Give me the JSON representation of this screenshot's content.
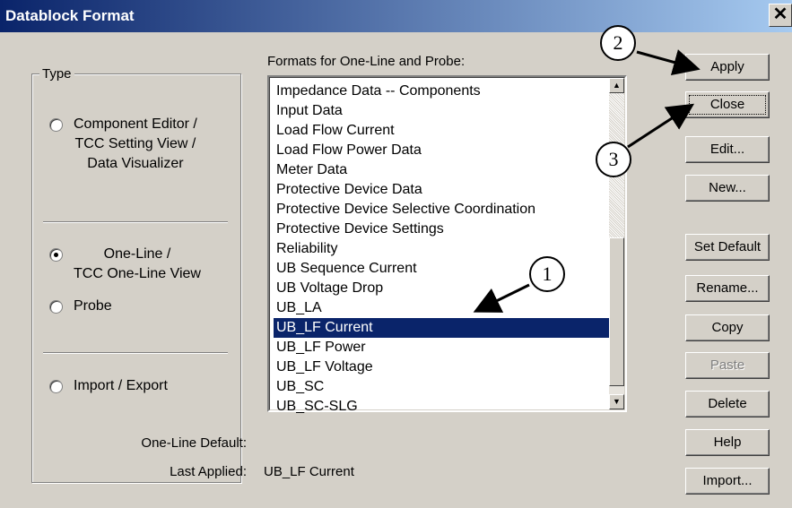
{
  "window": {
    "title": "Datablock Format",
    "close_glyph": "✕"
  },
  "type_group": {
    "legend": "Type",
    "options": [
      {
        "label": "Component Editor /\nTCC Setting View /\nData Visualizer",
        "checked": false
      },
      {
        "label": "One-Line /\nTCC One-Line View",
        "checked": true
      },
      {
        "label": "Probe",
        "checked": false
      },
      {
        "label": "Import / Export",
        "checked": false
      }
    ]
  },
  "formats": {
    "label": "Formats for One-Line and Probe:",
    "items": [
      "Impedance Data -- Components",
      "Input Data",
      "Load Flow Current",
      "Load Flow Power Data",
      "Meter Data",
      "Protective Device Data",
      "Protective Device Selective Coordination",
      "Protective Device Settings",
      "Reliability",
      "UB Sequence Current",
      "UB Voltage Drop",
      "UB_LA",
      "UB_LF Current",
      "UB_LF Power",
      "UB_LF Voltage",
      "UB_SC",
      "UB_SC-SLG"
    ],
    "selected": "UB_LF Current"
  },
  "info": {
    "one_line_default_label": "One-Line Default:",
    "one_line_default_value": "",
    "last_applied_label": "Last Applied:",
    "last_applied_value": "UB_LF Current"
  },
  "buttons": {
    "apply": "Apply",
    "close": "Close",
    "edit": "Edit...",
    "new": "New...",
    "set_default": "Set Default",
    "rename": "Rename...",
    "copy": "Copy",
    "paste": "Paste",
    "delete": "Delete",
    "help": "Help",
    "import": "Import..."
  },
  "callouts": {
    "c1": "1",
    "c2": "2",
    "c3": "3"
  },
  "colors": {
    "title_start": "#0a246a",
    "title_end": "#a6caf0",
    "selection": "#0a246a",
    "face": "#d4d0c8"
  }
}
